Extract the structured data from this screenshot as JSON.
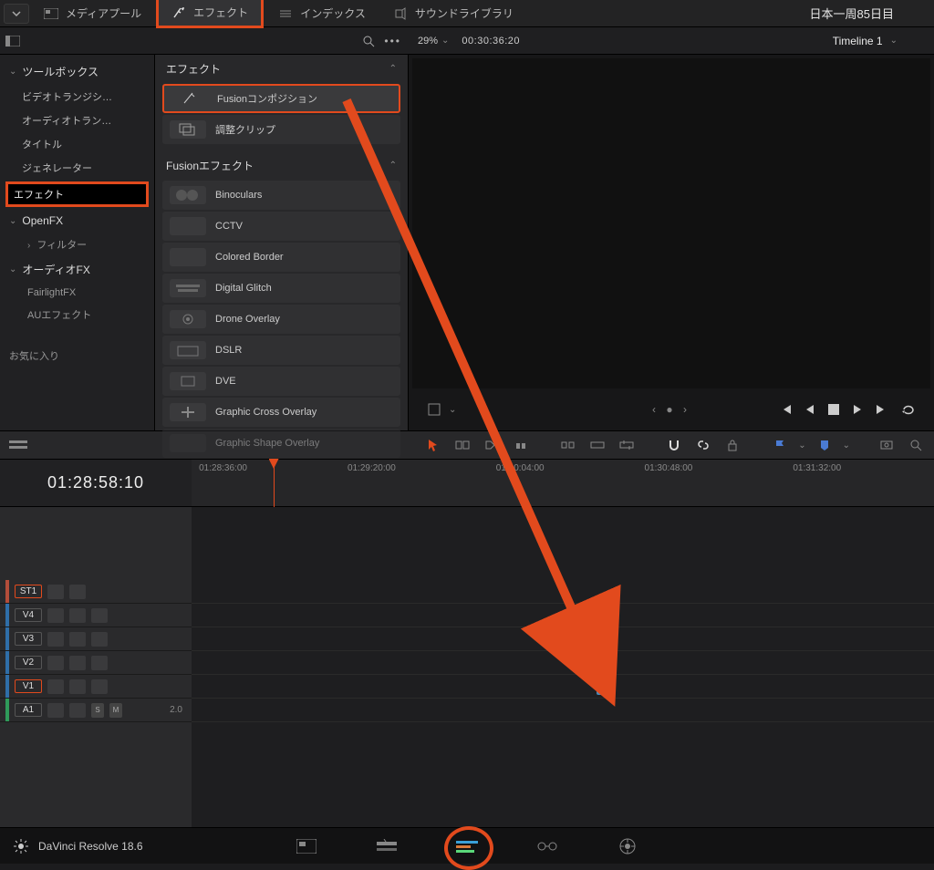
{
  "topbar": {
    "tabs": [
      {
        "label": "メディアプール",
        "icon": "media-icon"
      },
      {
        "label": "エフェクト",
        "icon": "fx-icon",
        "active": true,
        "highlighted": true
      },
      {
        "label": "インデックス",
        "icon": "index-icon"
      },
      {
        "label": "サウンドライブラリ",
        "icon": "sound-icon"
      }
    ],
    "project_title": "日本一周85日目"
  },
  "subbar": {
    "zoom_pct": "29%",
    "timecode": "00:30:36:20",
    "timeline_name": "Timeline 1"
  },
  "sidebar": {
    "toolbox_label": "ツールボックス",
    "items": [
      "ビデオトランジシ…",
      "オーディオトラン…",
      "タイトル",
      "ジェネレーター",
      "エフェクト"
    ],
    "selected_index": 4,
    "openfx_label": "OpenFX",
    "openfx_items": [
      "フィルター"
    ],
    "audiofx_label": "オーディオFX",
    "audiofx_items": [
      "FairlightFX",
      "AUエフェクト"
    ],
    "favorites_label": "お気に入り"
  },
  "fx": {
    "header_effects": "エフェクト",
    "items_top": [
      {
        "label": "Fusionコンポジション",
        "selected": true
      },
      {
        "label": "調整クリップ"
      }
    ],
    "header_fusion": "Fusionエフェクト",
    "items_fusion": [
      "Binoculars",
      "CCTV",
      "Colored Border",
      "Digital Glitch",
      "Drone Overlay",
      "DSLR",
      "DVE",
      "Graphic Cross Overlay",
      "Graphic Shape Overlay"
    ]
  },
  "transport": {
    "mark_dots": "‹ ● ›"
  },
  "timeline": {
    "playhead_tc": "01:28:58:10",
    "ruler": [
      {
        "label": "01:28:36:00",
        "pct": 0
      },
      {
        "label": "01:29:20:00",
        "pct": 20
      },
      {
        "label": "01:30:04:00",
        "pct": 40
      },
      {
        "label": "01:30:48:00",
        "pct": 60
      },
      {
        "label": "01:31:32:00",
        "pct": 80
      }
    ],
    "tracks": [
      {
        "name": "ST1",
        "edge": "#b34d3a",
        "hl": true
      },
      {
        "name": "V4",
        "edge": "#2f6ea8"
      },
      {
        "name": "V3",
        "edge": "#2f6ea8"
      },
      {
        "name": "V2",
        "edge": "#2f6ea8"
      },
      {
        "name": "V1",
        "edge": "#2f6ea8",
        "hl": true
      },
      {
        "name": "A1",
        "edge": "#2f9a5a",
        "audio": true,
        "gain": "2.0"
      }
    ]
  },
  "pages": {
    "brand": "DaVinci Resolve 18.6"
  }
}
